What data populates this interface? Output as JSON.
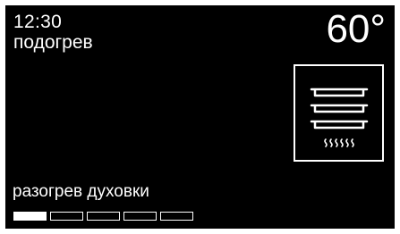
{
  "display": {
    "time": "12:30",
    "mode": "подогрев",
    "temperature": "60°",
    "status": "разогрев духовки",
    "icon": "oven-trays-bottom-heat-icon"
  },
  "progress": {
    "total_segments": 5,
    "filled_segments": 1
  },
  "colors": {
    "background": "#000000",
    "foreground": "#ffffff"
  }
}
